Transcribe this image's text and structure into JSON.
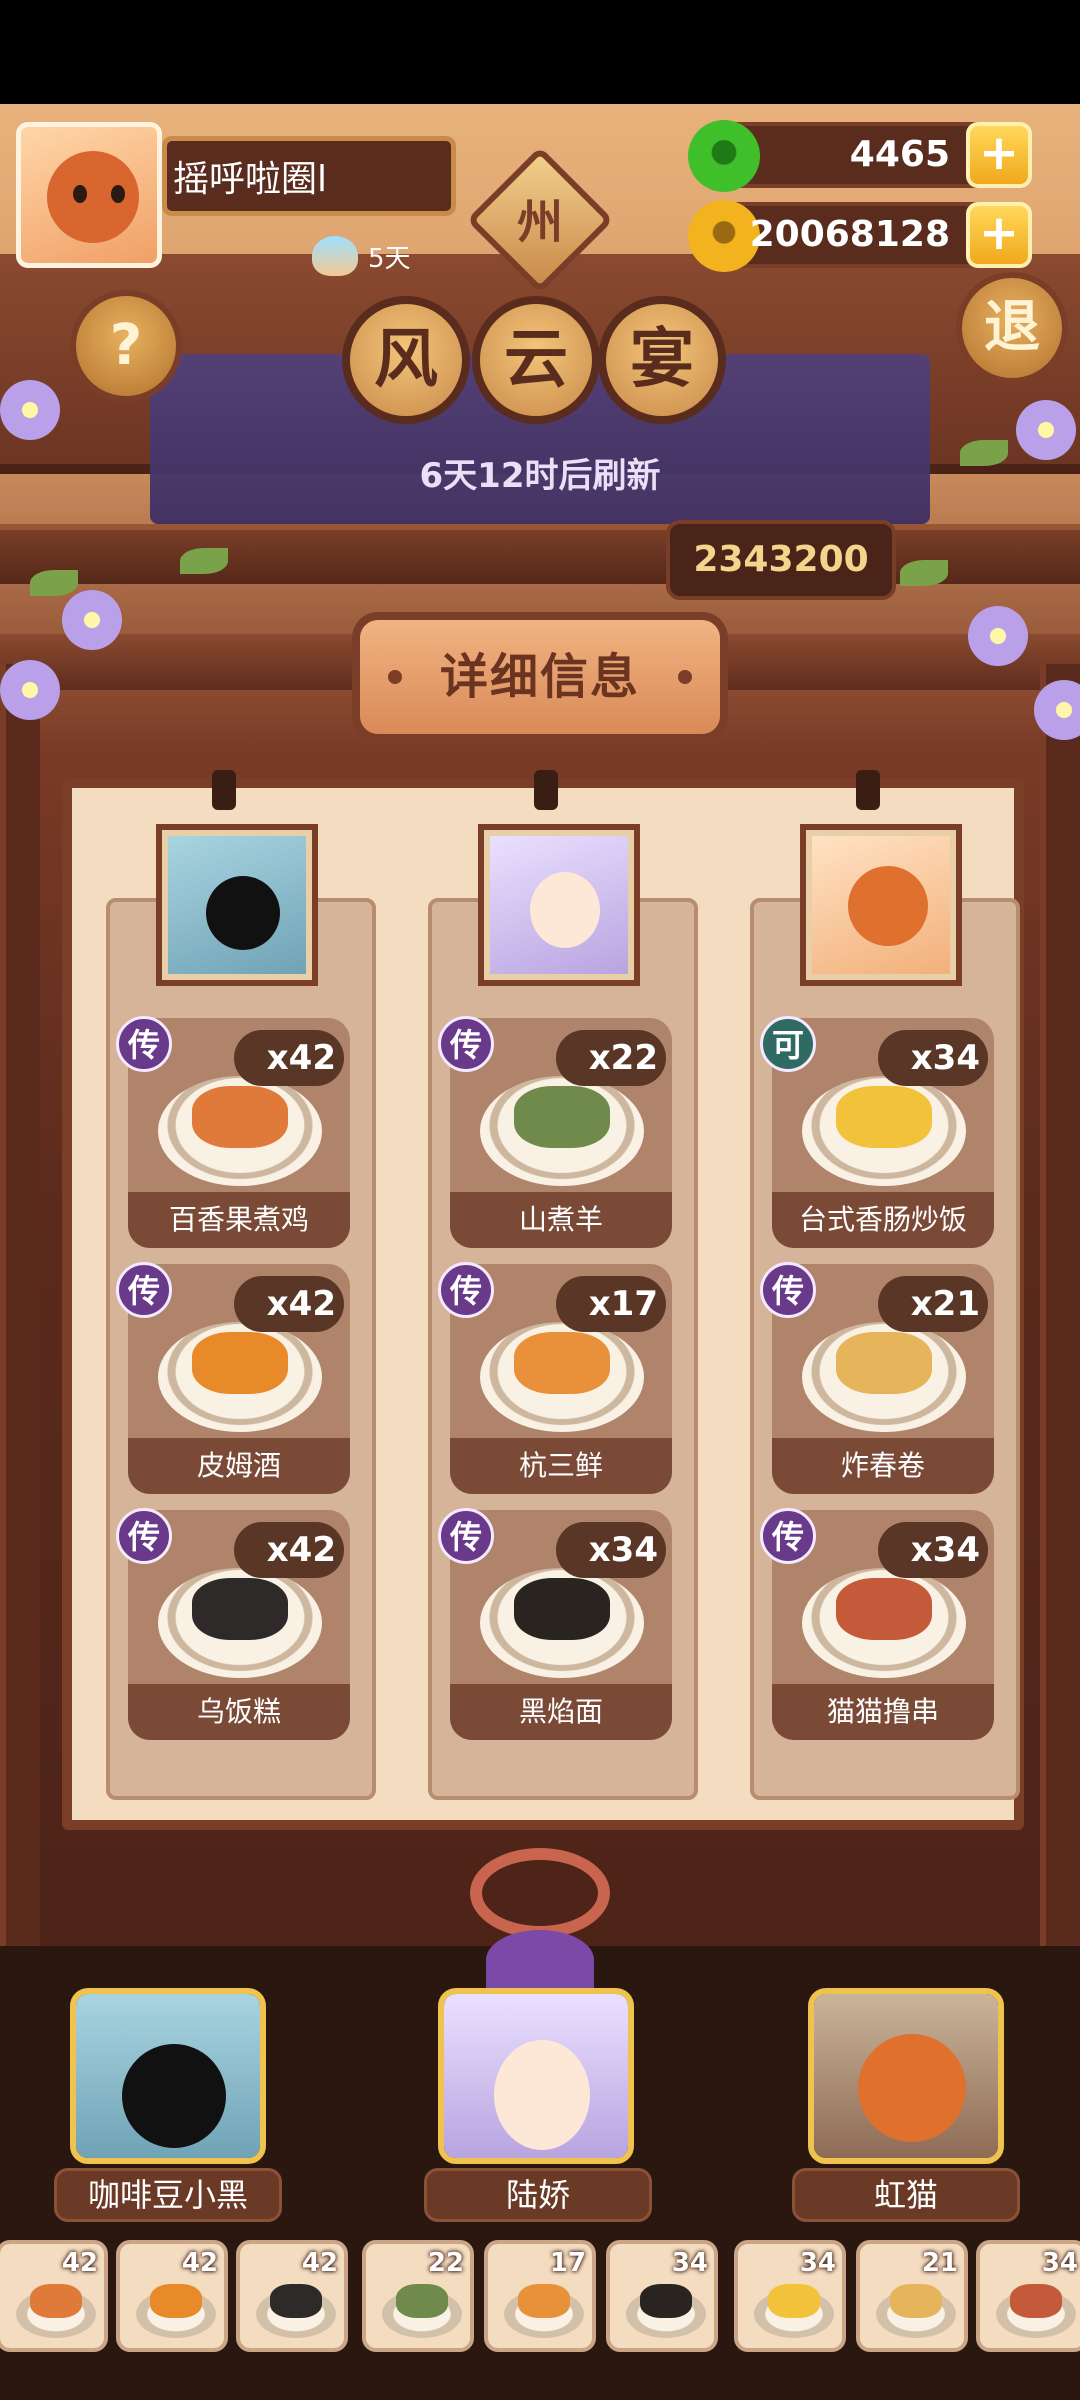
{
  "profile": {
    "name": "摇呼啦圈l",
    "days": "5天"
  },
  "city_badge": "州",
  "currency": {
    "jade": {
      "value": "4465",
      "color": "#3fbf2a"
    },
    "gold": {
      "value": "20068128",
      "color": "#f2b31f"
    }
  },
  "buttons": {
    "help": "?",
    "exit": "退"
  },
  "title": [
    "风",
    "云",
    "宴"
  ],
  "refresh_text": "6天12时后刷新",
  "score": "2343200",
  "detail_title": "详细信息",
  "columns": [
    {
      "character": "咖啡豆小黑",
      "dishes": [
        {
          "name": "百香果煮鸡",
          "count": "x42",
          "tag": "传",
          "food_color": "#e07a3a"
        },
        {
          "name": "皮姆酒",
          "count": "x42",
          "tag": "传",
          "food_color": "#e88a2a"
        },
        {
          "name": "乌饭糕",
          "count": "x42",
          "tag": "传",
          "food_color": "#2f2a2a"
        }
      ]
    },
    {
      "character": "陆娇",
      "dishes": [
        {
          "name": "山煮羊",
          "count": "x22",
          "tag": "传",
          "food_color": "#6f8a4a"
        },
        {
          "name": "杭三鲜",
          "count": "x17",
          "tag": "传",
          "food_color": "#e8903a"
        },
        {
          "name": "黑焰面",
          "count": "x34",
          "tag": "传",
          "food_color": "#2a2420"
        }
      ]
    },
    {
      "character": "虹猫",
      "dishes": [
        {
          "name": "台式香肠炒饭",
          "count": "x34",
          "tag": "可",
          "food_color": "#f2c23a"
        },
        {
          "name": "炸春卷",
          "count": "x21",
          "tag": "传",
          "food_color": "#e6b45a"
        },
        {
          "name": "猫猫撸串",
          "count": "x34",
          "tag": "传",
          "food_color": "#c45a3a"
        }
      ]
    }
  ],
  "bottom_characters": [
    {
      "name": "咖啡豆小黑",
      "color": "#7fb4c9"
    },
    {
      "name": "陆娇",
      "color": "#c7b3e8"
    },
    {
      "name": "虹猫",
      "color": "#e08a4a"
    }
  ],
  "strip": [
    {
      "count": "42",
      "food_color": "#e07a3a"
    },
    {
      "count": "42",
      "food_color": "#e88a2a"
    },
    {
      "count": "42",
      "food_color": "#2f2a2a"
    },
    {
      "count": "22",
      "food_color": "#6f8a4a"
    },
    {
      "count": "17",
      "food_color": "#e8903a"
    },
    {
      "count": "34",
      "food_color": "#2a2420"
    },
    {
      "count": "34",
      "food_color": "#f2c23a"
    },
    {
      "count": "21",
      "food_color": "#e6b45a"
    },
    {
      "count": "34",
      "food_color": "#c45a3a"
    }
  ]
}
